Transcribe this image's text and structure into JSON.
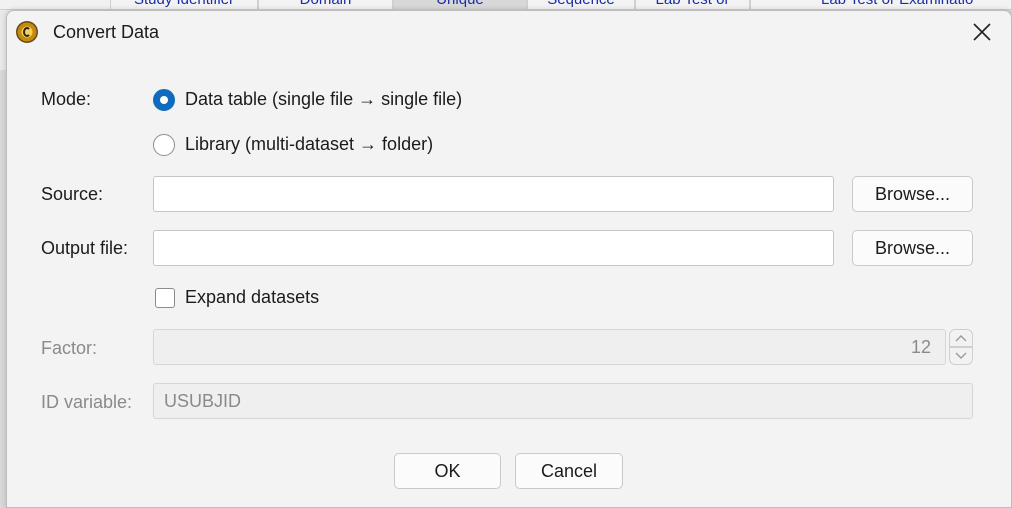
{
  "background_table": {
    "columns": [
      "Study Identifier",
      "Domain",
      "Unique",
      "Sequence",
      "Lab Test or",
      "Lab Test or Examinatio"
    ]
  },
  "dialog": {
    "title": "Convert Data",
    "icons": {
      "app": "app-logo-icon",
      "close": "close-icon",
      "spin_up": "chevron-up-icon",
      "spin_down": "chevron-down-icon"
    },
    "mode_label": "Mode:",
    "mode_options": [
      {
        "label": "Data table (single file → single file)",
        "selected": true
      },
      {
        "label": "Library (multi-dataset → folder)",
        "selected": false
      }
    ],
    "source_label": "Source:",
    "source_value": "",
    "source_browse": "Browse...",
    "output_label": "Output file:",
    "output_value": "",
    "output_browse": "Browse...",
    "expand_label": "Expand datasets",
    "expand_checked": false,
    "factor_label": "Factor:",
    "factor_value": "12",
    "id_label": "ID variable:",
    "id_value": "USUBJID",
    "ok_label": "OK",
    "cancel_label": "Cancel"
  },
  "colors": {
    "accent": "#0f6cbd",
    "disabled_text": "#8a8a8a",
    "header_link": "#1a2ea8"
  }
}
